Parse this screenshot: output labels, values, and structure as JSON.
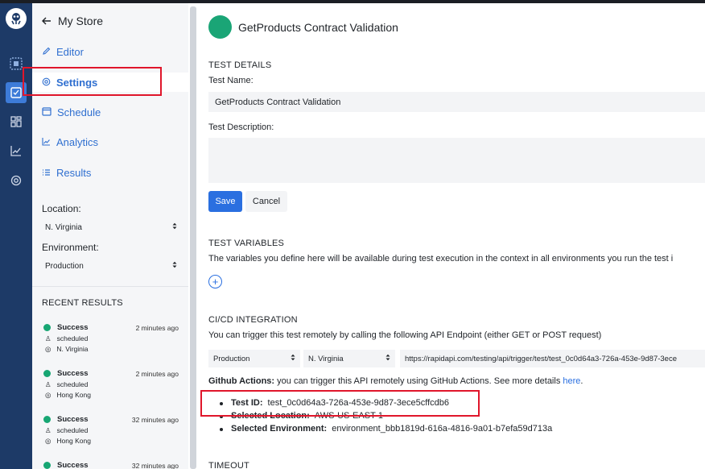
{
  "nav": {
    "store_title": "My Store",
    "items": [
      {
        "label": "Editor",
        "icon": "pencil-icon"
      },
      {
        "label": "Settings",
        "icon": "settings-icon"
      },
      {
        "label": "Schedule",
        "icon": "calendar-icon"
      },
      {
        "label": "Analytics",
        "icon": "chart-line-icon"
      },
      {
        "label": "Results",
        "icon": "list-icon"
      }
    ],
    "location_label": "Location:",
    "location_value": "N. Virginia",
    "environment_label": "Environment:",
    "environment_value": "Production",
    "recent_title": "RECENT RESULTS",
    "recent": [
      {
        "status": "Success",
        "time": "2 minutes ago",
        "trigger": "scheduled",
        "location": "N. Virginia"
      },
      {
        "status": "Success",
        "time": "2 minutes ago",
        "trigger": "scheduled",
        "location": "Hong Kong"
      },
      {
        "status": "Success",
        "time": "32 minutes ago",
        "trigger": "scheduled",
        "location": "Hong Kong"
      },
      {
        "status": "Success",
        "time": "32 minutes ago"
      }
    ]
  },
  "main": {
    "title": "GetProducts Contract Validation",
    "test_details": "TEST DETAILS",
    "test_name_label": "Test Name:",
    "test_name_value": "GetProducts Contract Validation",
    "test_desc_label": "Test Description:",
    "save": "Save",
    "cancel": "Cancel",
    "test_variables": "TEST VARIABLES",
    "variables_desc": "The variables you define here will be available during test execution in the context in all environments you run the test i",
    "plus": "+",
    "cicd": "CI/CD INTEGRATION",
    "cicd_desc": "You can trigger this test remotely by calling the following API Endpoint (either GET or POST request)",
    "ci_env": "Production",
    "ci_loc": "N. Virginia",
    "ci_url": "https://rapidapi.com/testing/api/trigger/test/test_0c0d64a3-726a-453e-9d87-3ece",
    "gh_bold": "Github Actions:",
    "gh_text": " you can trigger this API remotely using GitHub Actions. See more details ",
    "gh_link": "here",
    "gh_end": ".",
    "test_id_label": "Test ID:",
    "test_id_value": "test_0c0d64a3-726a-453e-9d87-3ece5cffcdb6",
    "sel_loc_label": "Selected Location:",
    "sel_loc_value": "AWS-US-EAST-1",
    "sel_env_label": "Selected Environment:",
    "sel_env_value": "environment_bbb1819d-616a-4816-9a01-b7efa59d713a",
    "timeout": "TIMEOUT"
  },
  "colors": {
    "rail": "#1d3a67",
    "accent": "#2a6fe0",
    "success": "#17a673",
    "highlight": "#e0162b"
  }
}
